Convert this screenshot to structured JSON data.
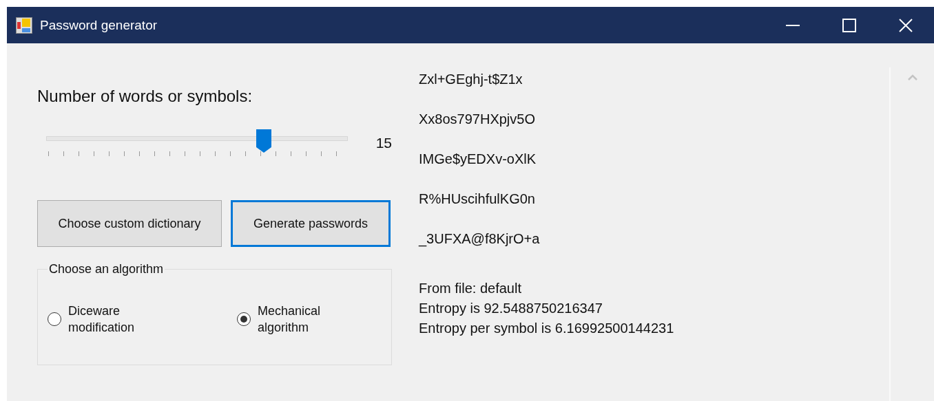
{
  "window": {
    "title": "Password generator"
  },
  "slider": {
    "label": "Number of words or symbols:",
    "level": 0.725,
    "reading": "15"
  },
  "buttons": [
    {
      "label": "Choose custom dictionary",
      "focused": false
    },
    {
      "label": "Generate passwords",
      "focused": true
    }
  ],
  "algorithm_group": {
    "title": "Choose an algorithm",
    "options": [
      {
        "label": "Diceware modification",
        "selected": false
      },
      {
        "label": "Mechanical algorithm",
        "selected": true
      }
    ]
  },
  "passwords": [
    "Zxl+GEghj-t$Z1x",
    "Xx8os797HXpjv5O",
    "IMGe$yEDXv-oXlK",
    "R%HUscihfulKG0n",
    "_3UFXA@f8KjrO+a"
  ],
  "info": [
    "From file: default",
    "Entropy is 92.5488750216347",
    "Entropy per symbol is 6.16992500144231"
  ]
}
